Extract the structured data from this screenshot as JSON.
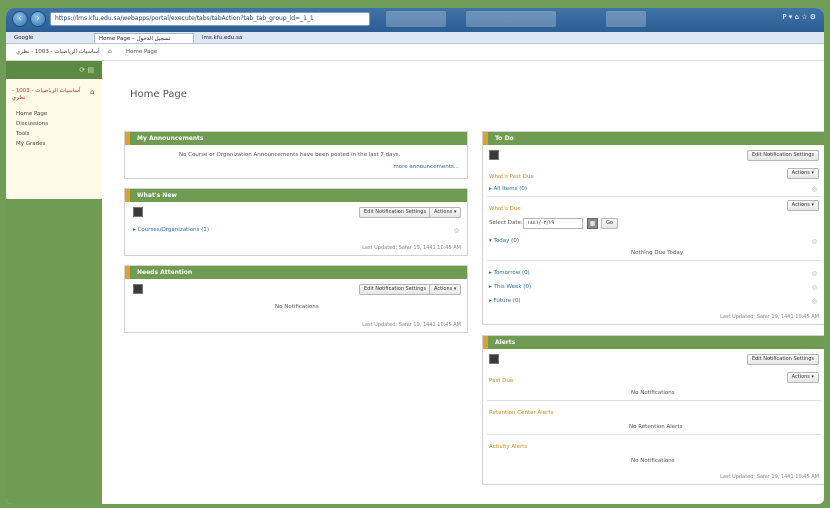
{
  "browser": {
    "address": "https://lms.kfu.edu.sa/webapps/portal/execute/tabs/tabAction?tab_tab_group_id=_1_1",
    "window_controls": "P ▾ ⌂ ☆ ⚙",
    "tabs": [
      {
        "label": "Google",
        "active": false
      },
      {
        "label": "Home Page – تسجيل الدخول",
        "active": true
      },
      {
        "label": "lms.kfu.edu.sa",
        "active": false
      }
    ]
  },
  "subheader": {
    "org_label": "أساسيات الرياضيات - 1003 - نظري",
    "page_label": "Home Page"
  },
  "sidebar": {
    "course_title": "أساسيات الرياضيات - 1003 - نظري",
    "links": [
      "Home Page",
      "Discussions",
      "Tools",
      "My Grades"
    ]
  },
  "main": {
    "title": "Home Page",
    "announcements": {
      "header": "My Announcements",
      "message": "No Course or Organization Announcements have been posted in the last 7 days.",
      "more_link": "more announcements..."
    },
    "whats_new": {
      "header": "What's New",
      "edit_btn": "Edit Notification Settings",
      "actions_btn": "Actions ▾",
      "item": "Courses/Organizations (1)",
      "updated": "Last Updated: Safar 19, 1441 10:45 AM"
    },
    "needs_attention": {
      "header": "Needs Attention",
      "edit_btn": "Edit Notification Settings",
      "actions_btn": "Actions ▾",
      "message": "No Notifications",
      "updated": "Last Updated: Safar 19, 1441 10:45 AM"
    },
    "todo": {
      "header": "To Do",
      "edit_btn": "Edit Notification Settings",
      "past_due_label": "What's Past Due",
      "actions_btn": "Actions ▾",
      "all_items": "All Items (0)",
      "due_label": "What's Due",
      "actions_btn2": "Actions ▾",
      "select_date_label": "Select Date:",
      "date_value": "١٤٤١/٠٢/١٩",
      "go_btn": "Go",
      "today": "Today (0)",
      "nothing_due": "Nothing Due Today",
      "tomorrow": "Tomorrow (0)",
      "this_week": "This Week (0)",
      "future": "Future (0)",
      "updated": "Last Updated: Safar 19, 1441 10:45 AM"
    },
    "alerts": {
      "header": "Alerts",
      "edit_btn": "Edit Notification Settings",
      "actions_btn": "Actions ▾",
      "past_due": "Past Due",
      "no_notifications": "No Notifications",
      "retention_label": "Retention Center Alerts",
      "no_retention": "No Retention Alerts",
      "activity_label": "Activity Alerts",
      "no_notifications2": "No Notifications",
      "updated": "Last Updated: Safar 19, 1441 10:45 AM"
    }
  },
  "colors": {
    "accent_green": "#6f9b53",
    "header_orange": "#e0a030",
    "browser_blue": "#2c5e93"
  }
}
